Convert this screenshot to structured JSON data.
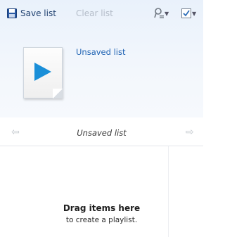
{
  "toolbar": {
    "save_label": "Save list",
    "clear_label": "Clear list"
  },
  "playlist": {
    "name_link": "Unsaved list",
    "nav_title": "Unsaved list"
  },
  "empty_state": {
    "title": "Drag items here",
    "subtitle": "to create a playlist."
  },
  "icons": {
    "save": "save-disk-icon",
    "list_options": "list-options-icon",
    "check_options": "checkbox-options-icon",
    "play": "play-icon",
    "back": "arrow-left-icon",
    "forward": "arrow-right-icon"
  },
  "colors": {
    "link": "#1f63b3",
    "disabled": "#b4bcc8",
    "play_button": "#1a8fd8"
  }
}
